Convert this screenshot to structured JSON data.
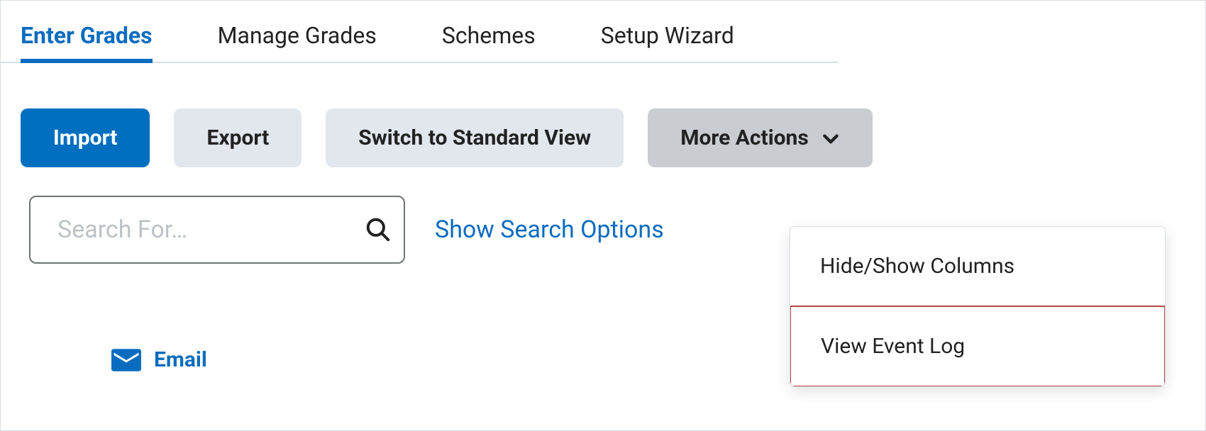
{
  "tabs": {
    "enter_grades": "Enter Grades",
    "manage_grades": "Manage Grades",
    "schemes": "Schemes",
    "setup_wizard": "Setup Wizard"
  },
  "toolbar": {
    "import": "Import",
    "export": "Export",
    "switch_view": "Switch to Standard View",
    "more_actions": "More Actions"
  },
  "search": {
    "placeholder": "Search For…",
    "show_options": "Show Search Options"
  },
  "email": {
    "label": "Email"
  },
  "dropdown": {
    "hide_show": "Hide/Show Columns",
    "view_event_log": "View Event Log"
  }
}
